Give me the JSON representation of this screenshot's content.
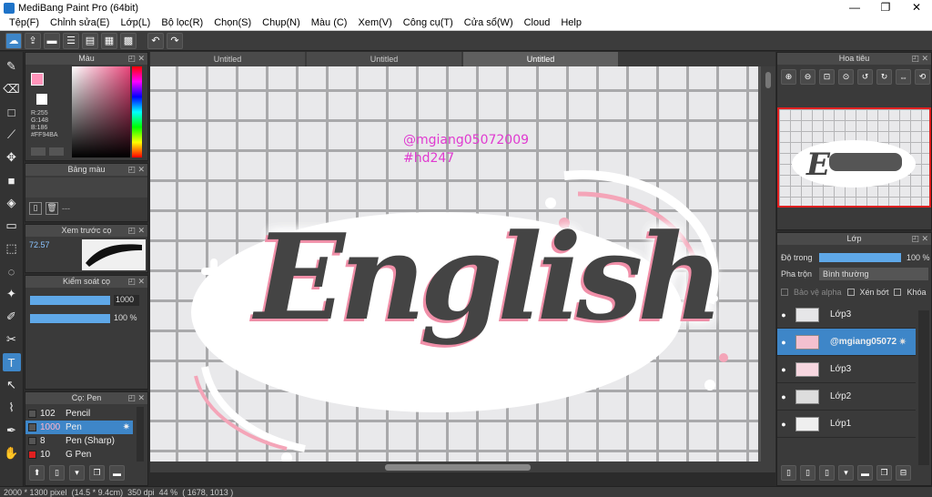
{
  "window": {
    "title": "MediBang Paint Pro (64bit)",
    "minimize": "—",
    "maximize": "❐",
    "close": "✕"
  },
  "menu": [
    "Tệp(F)",
    "Chỉnh sửa(E)",
    "Lớp(L)",
    "Bộ lọc(R)",
    "Chọn(S)",
    "Chụp(N)",
    "Màu (C)",
    "Xem(V)",
    "Công cụ(T)",
    "Cửa sổ(W)",
    "Cloud",
    "Help"
  ],
  "toolbar": [
    "cloud-icon",
    "share-icon",
    "comment-icon",
    "list-icon",
    "doc-icon",
    "layout-icon",
    "grid-icon",
    "undo-icon",
    "redo-icon"
  ],
  "color_panel": {
    "title": "Màu",
    "foreground": "#FF94BA",
    "rgb_r": "R:255",
    "rgb_g": "G:148",
    "rgb_b": "B:186",
    "hex": "#FF94BA"
  },
  "palette_panel": {
    "title": "Bảng màu",
    "value": "---"
  },
  "brush_preview": {
    "title": "Xem trước cọ",
    "size": "72.57"
  },
  "brush_control": {
    "title": "Kiểm soát cọ",
    "size_value": "1000",
    "opacity_value": "100 %"
  },
  "brush_panel": {
    "title": "Cọ: Pen",
    "items": [
      {
        "size": "102",
        "name": "Pencil",
        "color": "#555555"
      },
      {
        "size": "1000",
        "name": "Pen",
        "color": "#555555"
      },
      {
        "size": "8",
        "name": "Pen (Sharp)",
        "color": "#555555"
      },
      {
        "size": "10",
        "name": "G Pen",
        "color": "#e02020"
      }
    ]
  },
  "tabs": [
    "Untitled",
    "Untitled",
    "Untitled"
  ],
  "canvas": {
    "watermark_line1": "@mgiang05072009",
    "watermark_line2": "#hd247",
    "word": "English"
  },
  "navigator": {
    "title": "Hoa tiêu"
  },
  "layer_panel": {
    "title": "Lớp",
    "opacity_label": "Độ trong",
    "opacity_value": "100 %",
    "blend_label": "Pha trộn",
    "blend_value": "Bình thường",
    "protect_alpha": "Bảo vệ alpha",
    "clip": "Xén bớt",
    "lock": "Khóa",
    "layers": [
      {
        "name": "Lớp3"
      },
      {
        "name": "@mgiang05072"
      },
      {
        "name": "Lớp3"
      },
      {
        "name": "Lớp2"
      },
      {
        "name": "Lớp1"
      }
    ]
  },
  "status": {
    "size": "2000 * 1300 pixel",
    "cm": "(14.5 * 9.4cm)",
    "dpi": "350 dpi",
    "zoom": "44 %",
    "coords": "( 1678, 1013 )"
  }
}
